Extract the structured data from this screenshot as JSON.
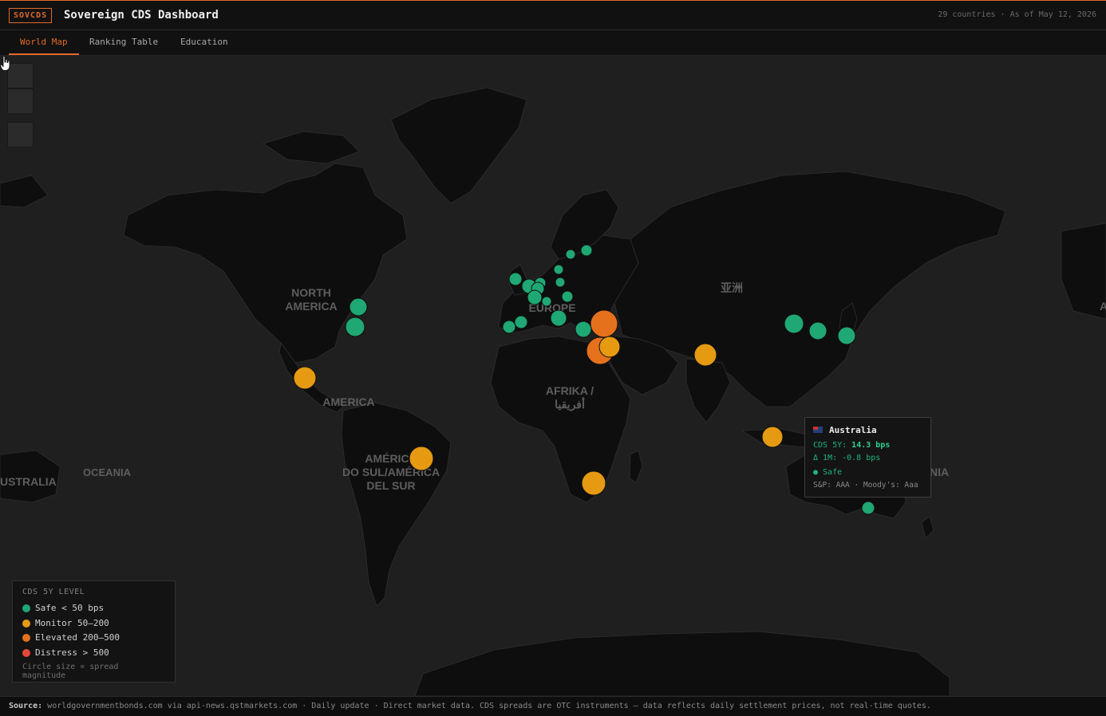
{
  "app": {
    "logo": "SOVCDS",
    "title": "Sovereign CDS Dashboard",
    "country_count": "29 countries",
    "separator": " · ",
    "as_of": "As of May 12, 2026"
  },
  "tabs": [
    {
      "label": "World Map",
      "active": true
    },
    {
      "label": "Ranking Table",
      "active": false
    },
    {
      "label": "Education",
      "active": false
    }
  ],
  "map": {
    "labels": {
      "north_america_1": "NORTH",
      "north_america_2": "AMERICA",
      "europe": "EUROPE",
      "asia": "亚洲",
      "africa_1": "AFRIKA /",
      "africa_2": "أفريقيا",
      "south_america_1": "AMÉRICA",
      "south_america_2": "DO SUL/AMÉRICA",
      "south_america_3": "DEL SUR",
      "central_america": "AMERICA",
      "oceania": "OCEANIA",
      "australia_left": "USTRALIA",
      "australia_right": "NIA",
      "asia_right": "A"
    },
    "colors": {
      "safe": "#1fa774",
      "monitor": "#e59a12",
      "elevated": "#e6711c",
      "distress": "#e5483a"
    }
  },
  "legend": {
    "title": "CDS 5Y LEVEL",
    "items": [
      {
        "label": "Safe < 50 bps",
        "color": "#1fa774"
      },
      {
        "label": "Monitor 50–200",
        "color": "#e59a12"
      },
      {
        "label": "Elevated 200–500",
        "color": "#e6711c"
      },
      {
        "label": "Distress > 500",
        "color": "#e5483a"
      }
    ],
    "note": "Circle size ∝ spread magnitude"
  },
  "tooltip": {
    "country": "Australia",
    "cds_label": "CDS 5Y: ",
    "cds_value": "14.3 bps",
    "delta": "Δ 1M: -0.8 bps",
    "status": "● Safe",
    "rating": "S&P: AAA · Moody's: Aaa"
  },
  "footer": {
    "source_label": "Source:",
    "text": " worldgovernmentbonds.com via api-news.qstmarkets.com · Daily update · Direct market data. CDS spreads are OTC instruments — data reflects daily settlement prices, not real-time quotes."
  },
  "icons": [
    "zoom-in-icon",
    "zoom-out-icon",
    "reset-view-icon",
    "hand-cursor-icon",
    "australia-flag-icon"
  ]
}
